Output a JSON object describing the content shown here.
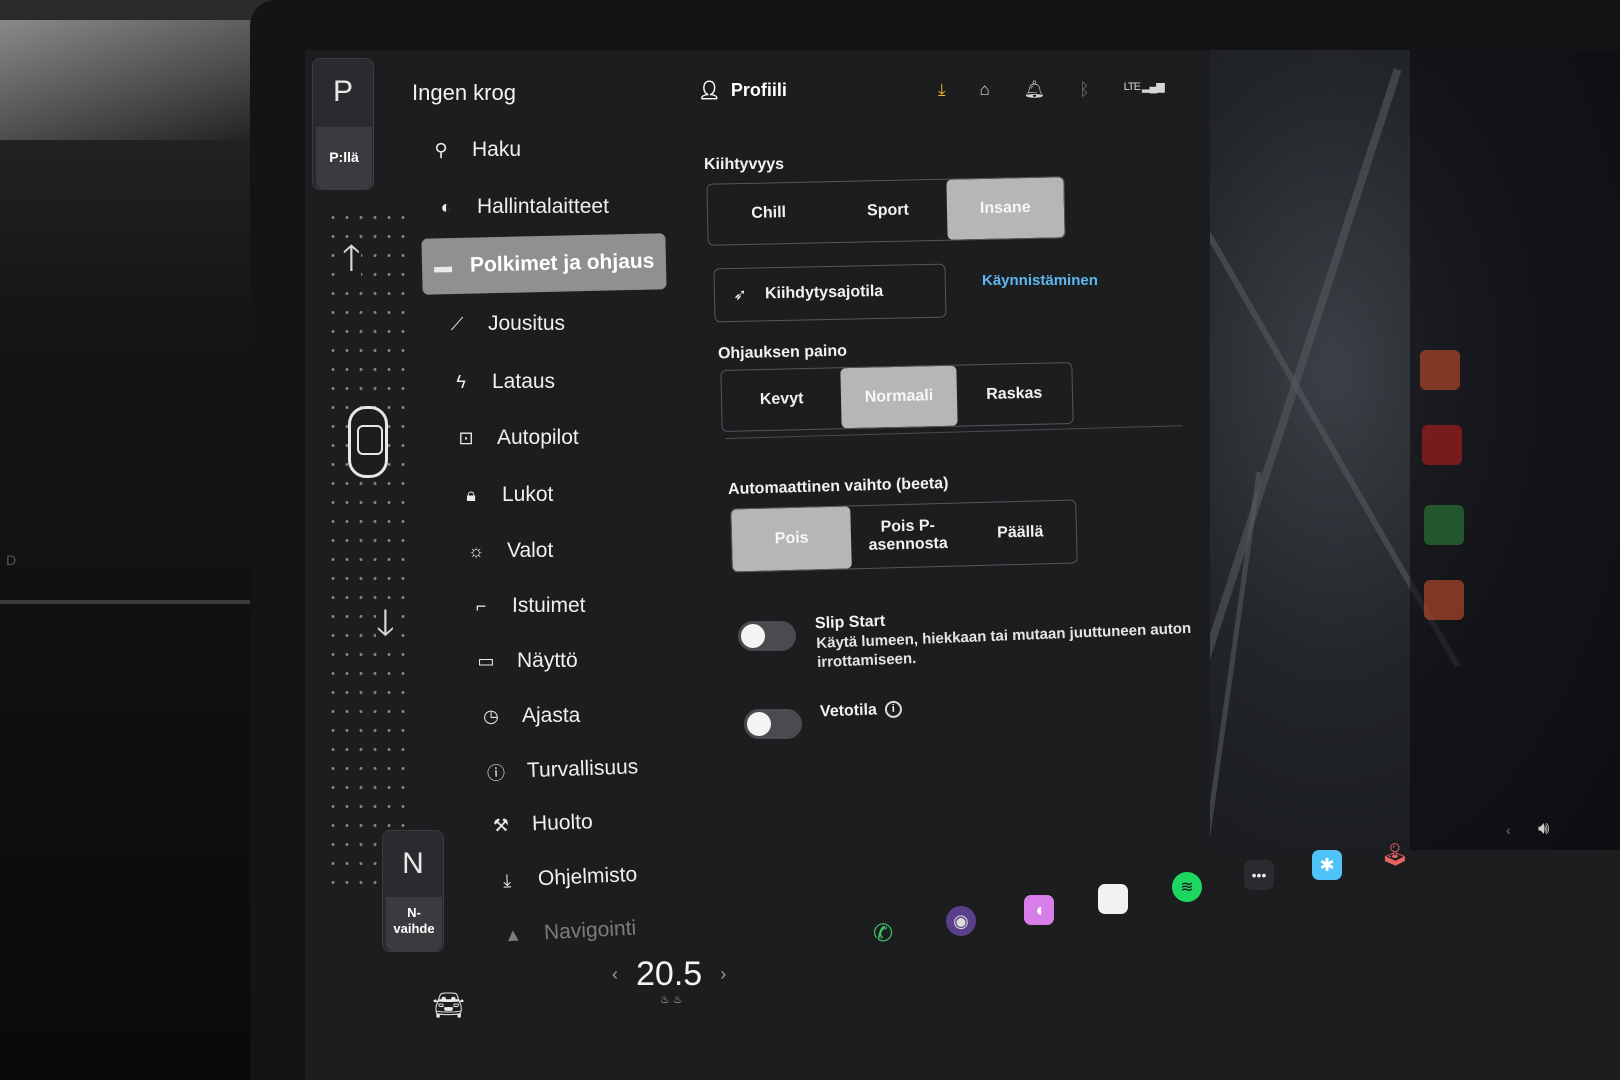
{
  "gear": {
    "top_letter": "P",
    "top_label": "P:llä",
    "bottom_letter": "N",
    "bottom_label": "N-\nvaihde"
  },
  "nav": {
    "title": "Ingen krog",
    "items": [
      {
        "label": "Haku",
        "icon": "search-icon",
        "glyph": "⚲"
      },
      {
        "label": "Hallintalaitteet",
        "icon": "toggle-icon",
        "glyph": "◐"
      },
      {
        "label": "Polkimet ja ohjaus",
        "icon": "car-icon",
        "glyph": "▬"
      },
      {
        "label": "Jousitus",
        "icon": "suspension-icon",
        "glyph": "⟋"
      },
      {
        "label": "Lataus",
        "icon": "lightning-icon",
        "glyph": "ϟ"
      },
      {
        "label": "Autopilot",
        "icon": "steering-icon",
        "glyph": "⊡"
      },
      {
        "label": "Lukot",
        "icon": "lock-icon",
        "glyph": "🔒︎"
      },
      {
        "label": "Valot",
        "icon": "sun-icon",
        "glyph": "☼"
      },
      {
        "label": "Istuimet",
        "icon": "seat-icon",
        "glyph": "⌐"
      },
      {
        "label": "Näyttö",
        "icon": "display-icon",
        "glyph": "▭"
      },
      {
        "label": "Ajasta",
        "icon": "alarm-icon",
        "glyph": "◷"
      },
      {
        "label": "Turvallisuus",
        "icon": "alert-icon",
        "glyph": "ⓘ"
      },
      {
        "label": "Huolto",
        "icon": "wrench-icon",
        "glyph": "⚒"
      },
      {
        "label": "Ohjelmisto",
        "icon": "download-icon",
        "glyph": "⤓"
      },
      {
        "label": "Navigointi",
        "icon": "navigation-icon",
        "glyph": "▲"
      }
    ]
  },
  "header": {
    "profile_label": "Profiili",
    "signal_label": "LTE"
  },
  "acceleration": {
    "label": "Kiihtyvyys",
    "options": [
      "Chill",
      "Sport",
      "Insane"
    ],
    "selected": "Insane"
  },
  "launch": {
    "button_label": "Kiihdytysajotila",
    "link_label": "Käynnistäminen"
  },
  "steering": {
    "label": "Ohjauksen paino",
    "options": [
      "Kevyt",
      "Normaali",
      "Raskas"
    ],
    "selected": "Normaali"
  },
  "auto_shift": {
    "label": "Automaattinen vaihto (beeta)",
    "options": [
      "Pois",
      "Pois P-\nasennosta",
      "Päällä"
    ],
    "selected": "Pois"
  },
  "slip_start": {
    "title": "Slip Start",
    "description": "Käytä lumeen, hiekkaan tai mutaan juuttuneen auton irrottamiseen.",
    "enabled": false
  },
  "traction": {
    "title": "Vetotila",
    "enabled": false
  },
  "climate": {
    "temperature": "20.5"
  },
  "colors": {
    "accent_link": "#5db8f0",
    "download": "#f0b429",
    "selected_segment": "#b5b6b8",
    "active_nav": "#8f9091"
  }
}
